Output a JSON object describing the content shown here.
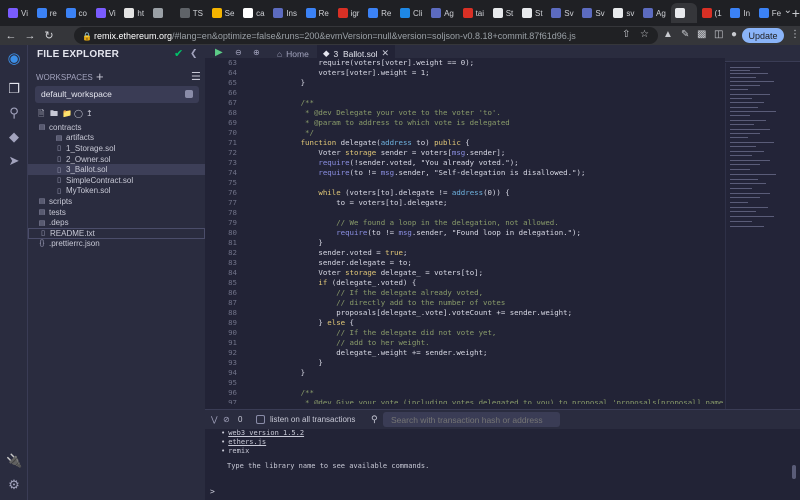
{
  "browser": {
    "tabs": [
      {
        "label": "Vi",
        "color": "#7a5cff"
      },
      {
        "label": "re",
        "color": "#3b82f6"
      },
      {
        "label": "co",
        "color": "#3b82f6"
      },
      {
        "label": "Vi",
        "color": "#7a5cff"
      },
      {
        "label": "ht",
        "color": "#e4e4e4"
      },
      {
        "label": "",
        "color": "#9aa0a6"
      },
      {
        "label": "TS",
        "color": "#5f6368"
      },
      {
        "label": "Se",
        "color": "#f4b400"
      },
      {
        "label": "ca",
        "color": "#ffffff"
      },
      {
        "label": "Ins",
        "color": "#5c6bc0"
      },
      {
        "label": "Re",
        "color": "#3b82f6"
      },
      {
        "label": "igr",
        "color": "#d93025"
      },
      {
        "label": "Re",
        "color": "#3b82f6"
      },
      {
        "label": "Cli",
        "color": "#1e88e5"
      },
      {
        "label": "Ag",
        "color": "#5c6bc0"
      },
      {
        "label": "tai",
        "color": "#d93025"
      },
      {
        "label": "St",
        "color": "#e8eaed"
      },
      {
        "label": "St",
        "color": "#e8eaed"
      },
      {
        "label": "Sv",
        "color": "#5c6bc0"
      },
      {
        "label": "Sv",
        "color": "#5c6bc0"
      },
      {
        "label": "sv",
        "color": "#e8eaed"
      },
      {
        "label": "Ag",
        "color": "#5c6bc0"
      },
      {
        "label": "",
        "color": "#e8eaed",
        "active": true
      },
      {
        "label": "(1",
        "color": "#d93025"
      },
      {
        "label": "In",
        "color": "#3b82f6"
      },
      {
        "label": "Fe",
        "color": "#3b82f6"
      }
    ],
    "new_tab": "+",
    "url_host": "remix.ethereum.org",
    "url_path": "/#lang=en&optimize=false&runs=200&evmVersion=null&version=soljson-v0.8.18+commit.87f61d96.js",
    "update_label": "Update"
  },
  "explorer": {
    "title": "FILE EXPLORER",
    "workspaces_label": "WORKSPACES",
    "workspace_name": "default_workspace",
    "tree": [
      {
        "label": "contracts",
        "type": "folder",
        "depth": 0
      },
      {
        "label": "artifacts",
        "type": "folder",
        "depth": 1
      },
      {
        "label": "1_Storage.sol",
        "type": "file",
        "depth": 1
      },
      {
        "label": "2_Owner.sol",
        "type": "file",
        "depth": 1
      },
      {
        "label": "3_Ballot.sol",
        "type": "file",
        "depth": 1,
        "selected": true
      },
      {
        "label": "SimpleContract.sol",
        "type": "file",
        "depth": 1
      },
      {
        "label": "MyToken.sol",
        "type": "file",
        "depth": 1
      },
      {
        "label": "scripts",
        "type": "folder",
        "depth": 0
      },
      {
        "label": "tests",
        "type": "folder",
        "depth": 0
      },
      {
        "label": ".deps",
        "type": "folder",
        "depth": 0
      },
      {
        "label": "README.txt",
        "type": "file",
        "depth": 0,
        "highlighted": true
      },
      {
        "label": ".prettierrc.json",
        "type": "config",
        "depth": 0
      }
    ]
  },
  "editor": {
    "tabs": [
      {
        "label": "Home",
        "active": false
      },
      {
        "label": "3_Ballot.sol",
        "active": true
      }
    ],
    "lines": [
      {
        "n": "63",
        "t": [
          [
            "c-text",
            "            require(voters[voter].weight == 0);"
          ]
        ]
      },
      {
        "n": "64",
        "t": [
          [
            "c-text",
            "            voters[voter].weight = 1;"
          ]
        ]
      },
      {
        "n": "65",
        "t": [
          [
            "c-text",
            "        }"
          ]
        ]
      },
      {
        "n": "66",
        "t": []
      },
      {
        "n": "67",
        "t": [
          [
            "c-com",
            "        /**"
          ]
        ]
      },
      {
        "n": "68",
        "t": [
          [
            "c-com",
            "         * @dev Delegate your vote to the voter 'to'."
          ]
        ]
      },
      {
        "n": "69",
        "t": [
          [
            "c-com",
            "         * @param to address to which vote is delegated"
          ]
        ]
      },
      {
        "n": "70",
        "t": [
          [
            "c-com",
            "         */"
          ]
        ]
      },
      {
        "n": "71",
        "t": [
          [
            "c-kw",
            "        function "
          ],
          [
            "c-text",
            "delegate("
          ],
          [
            "c-ty",
            "address"
          ],
          [
            "c-text",
            " to) "
          ],
          [
            "c-kw",
            "public"
          ],
          [
            "c-text",
            " {"
          ]
        ]
      },
      {
        "n": "72",
        "t": [
          [
            "c-text",
            "            Voter "
          ],
          [
            "c-kw",
            "storage"
          ],
          [
            "c-text",
            " sender = voters["
          ],
          [
            "c-msg",
            "msg"
          ],
          [
            "c-text",
            ".sender];"
          ]
        ]
      },
      {
        "n": "73",
        "t": [
          [
            "c-msg",
            "            require"
          ],
          [
            "c-text",
            "(!sender.voted, \"You already voted.\");"
          ]
        ]
      },
      {
        "n": "74",
        "t": [
          [
            "c-msg",
            "            require"
          ],
          [
            "c-text",
            "(to != "
          ],
          [
            "c-msg",
            "msg"
          ],
          [
            "c-text",
            ".sender, \"Self-delegation is disallowed.\");"
          ]
        ]
      },
      {
        "n": "75",
        "t": []
      },
      {
        "n": "76",
        "t": [
          [
            "c-kw",
            "            while"
          ],
          [
            "c-text",
            " (voters[to].delegate != "
          ],
          [
            "c-ty",
            "address"
          ],
          [
            "c-text",
            "(0)) {"
          ]
        ]
      },
      {
        "n": "77",
        "t": [
          [
            "c-text",
            "                to = voters[to].delegate;"
          ]
        ]
      },
      {
        "n": "78",
        "t": []
      },
      {
        "n": "79",
        "t": [
          [
            "c-com",
            "                // We found a loop in the delegation, not allowed."
          ]
        ]
      },
      {
        "n": "80",
        "t": [
          [
            "c-msg",
            "                require"
          ],
          [
            "c-text",
            "(to != "
          ],
          [
            "c-msg",
            "msg"
          ],
          [
            "c-text",
            ".sender, \"Found loop in delegation.\");"
          ]
        ]
      },
      {
        "n": "81",
        "t": [
          [
            "c-text",
            "            }"
          ]
        ]
      },
      {
        "n": "82",
        "t": [
          [
            "c-text",
            "            sender.voted = "
          ],
          [
            "c-kw",
            "true"
          ],
          [
            "c-text",
            ";"
          ]
        ]
      },
      {
        "n": "83",
        "t": [
          [
            "c-text",
            "            sender.delegate = to;"
          ]
        ]
      },
      {
        "n": "84",
        "t": [
          [
            "c-text",
            "            Voter "
          ],
          [
            "c-kw",
            "storage"
          ],
          [
            "c-text",
            " delegate_ = voters[to];"
          ]
        ]
      },
      {
        "n": "85",
        "t": [
          [
            "c-kw",
            "            if"
          ],
          [
            "c-text",
            " (delegate_.voted) {"
          ]
        ]
      },
      {
        "n": "86",
        "t": [
          [
            "c-com",
            "                // If the delegate already voted,"
          ]
        ]
      },
      {
        "n": "87",
        "t": [
          [
            "c-com",
            "                // directly add to the number of votes"
          ]
        ]
      },
      {
        "n": "88",
        "t": [
          [
            "c-text",
            "                proposals[delegate_.vote].voteCount += sender.weight;"
          ]
        ]
      },
      {
        "n": "89",
        "t": [
          [
            "c-text",
            "            } "
          ],
          [
            "c-kw",
            "else"
          ],
          [
            "c-text",
            " {"
          ]
        ]
      },
      {
        "n": "90",
        "t": [
          [
            "c-com",
            "                // If the delegate did not vote yet,"
          ]
        ]
      },
      {
        "n": "91",
        "t": [
          [
            "c-com",
            "                // add to her weight."
          ]
        ]
      },
      {
        "n": "92",
        "t": [
          [
            "c-text",
            "                delegate_.weight += sender.weight;"
          ]
        ]
      },
      {
        "n": "93",
        "t": [
          [
            "c-text",
            "            }"
          ]
        ]
      },
      {
        "n": "94",
        "t": [
          [
            "c-text",
            "        }"
          ]
        ]
      },
      {
        "n": "95",
        "t": []
      },
      {
        "n": "96",
        "t": [
          [
            "c-com",
            "        /**"
          ]
        ]
      },
      {
        "n": "97",
        "t": [
          [
            "c-com",
            "         * @dev Give your vote (including votes delegated to you) to proposal 'proposals[proposal].name'."
          ]
        ]
      }
    ]
  },
  "terminal": {
    "count": "0",
    "listen_label": "listen on all transactions",
    "search_placeholder": "Search with transaction hash or address",
    "lines": [
      {
        "text": "web3 version 1.5.2",
        "link": true,
        "bullet": true
      },
      {
        "text": "ethers.js",
        "link": true,
        "bullet": true
      },
      {
        "text": "remix",
        "link": false,
        "bullet": true
      },
      {
        "text": "Type the library name to see available commands.",
        "link": false,
        "bullet": false
      }
    ],
    "prompt": ">"
  },
  "colors": {
    "accent_run": "#5dcc87",
    "accent_check": "#00c46a",
    "update_button": "#8ab4f8"
  }
}
